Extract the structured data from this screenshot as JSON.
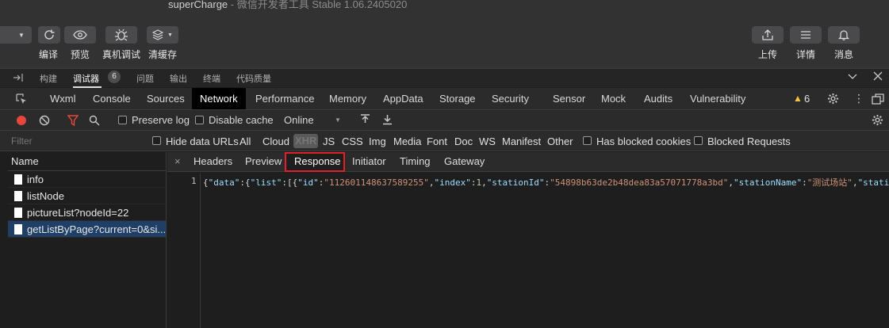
{
  "window": {
    "app": "superCharge",
    "sub": " - 微信开发者工具 Stable 1.06.2405020"
  },
  "toolbar": {
    "compile": "编译",
    "preview": "预览",
    "real_debug": "真机调试",
    "clear_cache": "清缓存",
    "upload": "上传",
    "details": "详情",
    "messages": "消息"
  },
  "devtools_tabs": {
    "build": "构建",
    "debugger": "调试器",
    "debugger_count": "6",
    "issues": "问题",
    "output": "输出",
    "terminal": "终端",
    "code_quality": "代码质量"
  },
  "panel_tabs": [
    "Wxml",
    "Console",
    "Sources",
    "Network",
    "Performance",
    "Memory",
    "AppData",
    "Storage",
    "Security",
    "Sensor",
    "Mock",
    "Audits",
    "Vulnerability"
  ],
  "warnings": "6",
  "network_toolbar": {
    "preserve_log": "Preserve log",
    "disable_cache": "Disable cache",
    "throttle": "Online"
  },
  "filter": {
    "placeholder": "Filter",
    "hide_data_urls": "Hide data URLs",
    "types": [
      "All",
      "Cloud",
      "XHR",
      "JS",
      "CSS",
      "Img",
      "Media",
      "Font",
      "Doc",
      "WS",
      "Manifest",
      "Other"
    ],
    "has_blocked_cookies": "Has blocked cookies",
    "blocked_requests": "Blocked Requests"
  },
  "requests": {
    "header": "Name",
    "items": [
      "info",
      "listNode",
      "pictureList?nodeId=22",
      "getListByPage?current=0&si..."
    ]
  },
  "detail_tabs": {
    "close": "×",
    "headers": "Headers",
    "preview": "Preview",
    "response": "Response",
    "initiator": "Initiator",
    "timing": "Timing",
    "gateway": "Gateway"
  },
  "response": {
    "line": "1",
    "t1": "{",
    "k_data": "\"data\"",
    "t2": ":{",
    "k_list": "\"list\"",
    "t3": ":[{",
    "k_id": "\"id\"",
    "t4": ":",
    "v_id": "\"112601148637589255\"",
    "t5": ",",
    "k_index": "\"index\"",
    "t6": ":",
    "v_index": "1",
    "t7": ",",
    "k_station_id": "\"stationId\"",
    "t8": ":",
    "v_station_id": "\"54898b63de2b48dea83a57071778a3bd\"",
    "t9": ",",
    "k_station_name": "\"stationName\"",
    "t10": ":",
    "v_station_name": "\"测试场站\"",
    "t11": ",",
    "k_trunc": "\"stati"
  }
}
